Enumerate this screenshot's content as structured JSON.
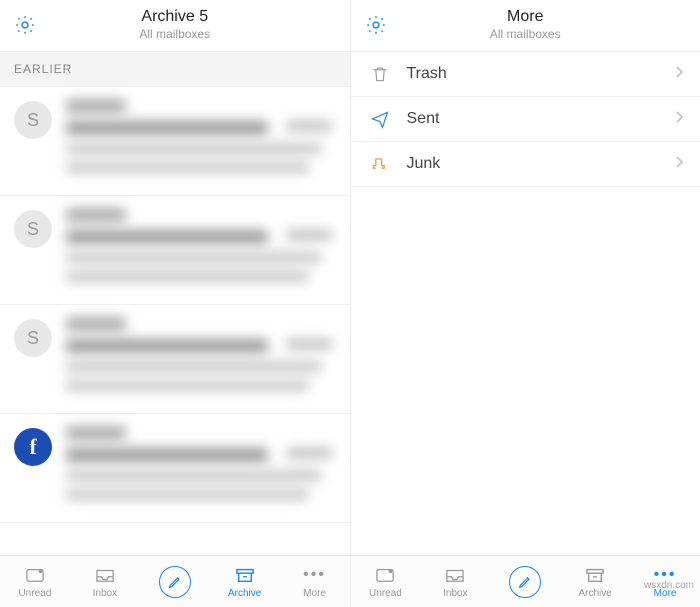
{
  "left": {
    "title": "Archive 5",
    "subtitle": "All mailboxes",
    "section": "EARLIER",
    "messages": [
      {
        "avatar": "S",
        "type": "letter"
      },
      {
        "avatar": "S",
        "type": "letter"
      },
      {
        "avatar": "S",
        "type": "letter"
      },
      {
        "avatar": "f",
        "type": "fb"
      }
    ]
  },
  "right": {
    "title": "More",
    "subtitle": "All mailboxes",
    "rows": [
      {
        "label": "Trash",
        "icon": "trash"
      },
      {
        "label": "Sent",
        "icon": "sent"
      },
      {
        "label": "Junk",
        "icon": "junk"
      }
    ]
  },
  "tabs": {
    "leftSet": [
      {
        "label": "Unread",
        "icon": "unread",
        "active": false
      },
      {
        "label": "Inbox",
        "icon": "inbox",
        "active": false
      },
      {
        "label": "",
        "icon": "compose",
        "active": false
      },
      {
        "label": "Archive",
        "icon": "archive",
        "active": true
      },
      {
        "label": "More",
        "icon": "more",
        "active": false
      }
    ],
    "rightSet": [
      {
        "label": "Unread",
        "icon": "unread",
        "active": false
      },
      {
        "label": "Inbox",
        "icon": "inbox",
        "active": false
      },
      {
        "label": "",
        "icon": "compose",
        "active": false
      },
      {
        "label": "Archive",
        "icon": "archive",
        "active": false
      },
      {
        "label": "More",
        "icon": "more",
        "active": true
      }
    ]
  },
  "watermark": "wsxdn.com",
  "icons": {
    "gear": "gear-icon",
    "trash": "trash-icon",
    "sent": "sent-icon",
    "junk": "junk-icon",
    "chevron": "chevron-right-icon"
  }
}
